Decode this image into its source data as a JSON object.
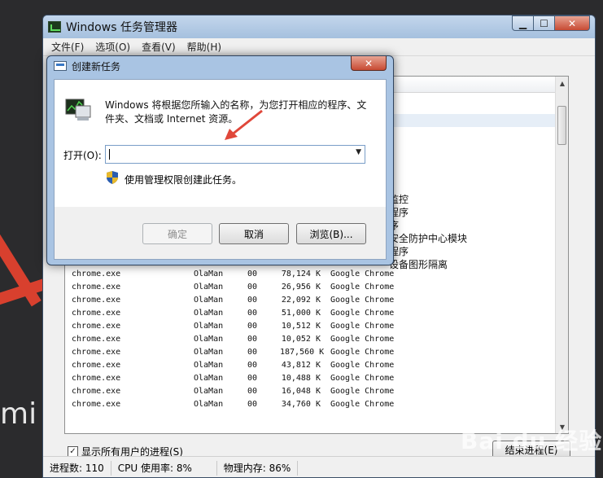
{
  "task_manager": {
    "title": "Windows 任务管理器",
    "menu": [
      "文件(F)",
      "选项(O)",
      "查看(V)",
      "帮助(H)"
    ],
    "visible_descriptions": [
      "监控",
      "程序",
      "序",
      "安全防护中心模块",
      "程序",
      "设备图形隔离"
    ],
    "rows": [
      {
        "image": "chrome.exe",
        "user": "OlaMan",
        "cpu": "00",
        "mem": "78,124 K",
        "desc": "Google Chrome"
      },
      {
        "image": "chrome.exe",
        "user": "OlaMan",
        "cpu": "00",
        "mem": "26,956 K",
        "desc": "Google Chrome"
      },
      {
        "image": "chrome.exe",
        "user": "OlaMan",
        "cpu": "00",
        "mem": "22,092 K",
        "desc": "Google Chrome"
      },
      {
        "image": "chrome.exe",
        "user": "OlaMan",
        "cpu": "00",
        "mem": "51,000 K",
        "desc": "Google Chrome"
      },
      {
        "image": "chrome.exe",
        "user": "OlaMan",
        "cpu": "00",
        "mem": "10,512 K",
        "desc": "Google Chrome"
      },
      {
        "image": "chrome.exe",
        "user": "OlaMan",
        "cpu": "00",
        "mem": "10,052 K",
        "desc": "Google Chrome"
      },
      {
        "image": "chrome.exe",
        "user": "OlaMan",
        "cpu": "00",
        "mem": "187,560 K",
        "desc": "Google Chrome"
      },
      {
        "image": "chrome.exe",
        "user": "OlaMan",
        "cpu": "00",
        "mem": "43,812 K",
        "desc": "Google Chrome"
      },
      {
        "image": "chrome.exe",
        "user": "OlaMan",
        "cpu": "00",
        "mem": "10,488 K",
        "desc": "Google Chrome"
      },
      {
        "image": "chrome.exe",
        "user": "OlaMan",
        "cpu": "00",
        "mem": "16,048 K",
        "desc": "Google Chrome"
      },
      {
        "image": "chrome.exe",
        "user": "OlaMan",
        "cpu": "00",
        "mem": "34,760 K",
        "desc": "Google Chrome"
      }
    ],
    "show_all_label": "显示所有用户的进程(S)",
    "show_all_checked": "✓",
    "end_process_label": "结束进程(E)",
    "status": {
      "processes": "进程数: 110",
      "cpu": "CPU 使用率: 8%",
      "memory": "物理内存: 86%"
    }
  },
  "dialog": {
    "title": "创建新任务",
    "description": "Windows 将根据您所输入的名称，为您打开相应的程序、文件夹、文档或 Internet 资源。",
    "open_label": "打开(O):",
    "open_value": "",
    "admin_label": "使用管理权限创建此任务。",
    "ok_label": "确定",
    "cancel_label": "取消",
    "browse_label": "浏览(B)..."
  },
  "background": {
    "partial_text": "mi",
    "watermark": "Bai du 经验"
  },
  "colors": {
    "title_bar": "#a8c3e0",
    "close_button": "#c74a33",
    "arrow": "#e0473a"
  }
}
